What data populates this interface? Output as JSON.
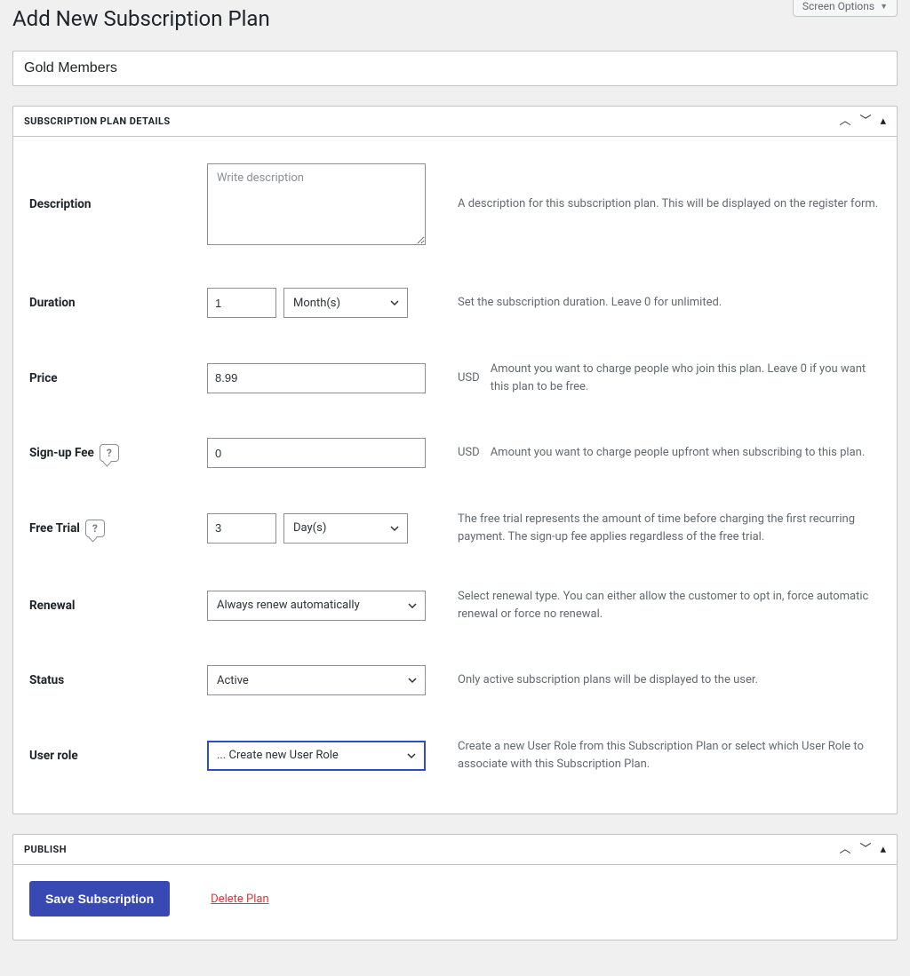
{
  "screen_options_label": "Screen Options",
  "page_title": "Add New Subscription Plan",
  "title_value": "Gold Members",
  "details_panel_title": "SUBSCRIPTION PLAN DETAILS",
  "description": {
    "label": "Description",
    "placeholder": "Write description",
    "value": "",
    "hint": "A description for this subscription plan. This will be displayed on the register form."
  },
  "duration": {
    "label": "Duration",
    "value": "1",
    "unit": "Month(s)",
    "hint": "Set the subscription duration. Leave 0 for unlimited."
  },
  "price": {
    "label": "Price",
    "value": "8.99",
    "currency": "USD",
    "hint": "Amount you want to charge people who join this plan. Leave 0 if you want this plan to be free."
  },
  "signup_fee": {
    "label": "Sign-up Fee",
    "value": "0",
    "currency": "USD",
    "hint": "Amount you want to charge people upfront when subscribing to this plan."
  },
  "free_trial": {
    "label": "Free Trial",
    "value": "3",
    "unit": "Day(s)",
    "hint": "The free trial represents the amount of time before charging the first recurring payment. The sign-up fee applies regardless of the free trial."
  },
  "renewal": {
    "label": "Renewal",
    "value": "Always renew automatically",
    "hint": "Select renewal type. You can either allow the customer to opt in, force automatic renewal or force no renewal."
  },
  "status": {
    "label": "Status",
    "value": "Active",
    "hint": "Only active subscription plans will be displayed to the user."
  },
  "user_role": {
    "label": "User role",
    "value": "... Create new User Role",
    "hint": "Create a new User Role from this Subscription Plan or select which User Role to associate with this Subscription Plan."
  },
  "publish_panel_title": "PUBLISH",
  "save_label": "Save Subscription",
  "delete_label": "Delete Plan",
  "help_glyph": "?"
}
